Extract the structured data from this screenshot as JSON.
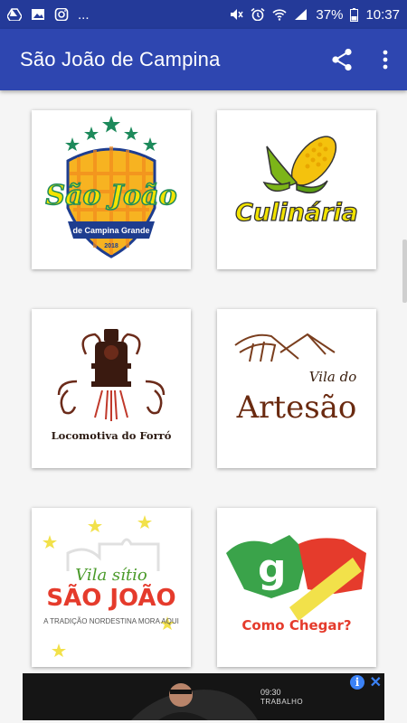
{
  "status_bar": {
    "notification_icons": [
      "drive-icon",
      "image-icon",
      "instagram-icon"
    ],
    "overflow": "...",
    "system_icons": [
      "mute-icon",
      "alarm-icon",
      "wifi-icon",
      "signal-icon"
    ],
    "battery": "37%",
    "time": "10:37"
  },
  "app_bar": {
    "title": "São João de Campina",
    "actions": [
      "share-icon",
      "more-vert-icon"
    ]
  },
  "tiles": [
    {
      "label": "São João",
      "sublabel": "de Campina Grande",
      "year": "2018"
    },
    {
      "label": "Culinária"
    },
    {
      "label": "Locomotiva do Forró"
    },
    {
      "label_line1": "Vila do",
      "label_line2": "Artesão"
    },
    {
      "label_line1": "Vila sítio",
      "label_line2": "SÃO JOÃO",
      "tagline": "A TRADIÇÃO NORDESTINA MORA AQUI"
    },
    {
      "label": "Como Chegar?"
    }
  ],
  "ad": {
    "time": "09:30",
    "text": "TRABALHO",
    "info": "i",
    "close": "✕"
  },
  "colors": {
    "status_bar": "#243a99",
    "app_bar": "#2e46b0",
    "background": "#f5f5f5"
  }
}
